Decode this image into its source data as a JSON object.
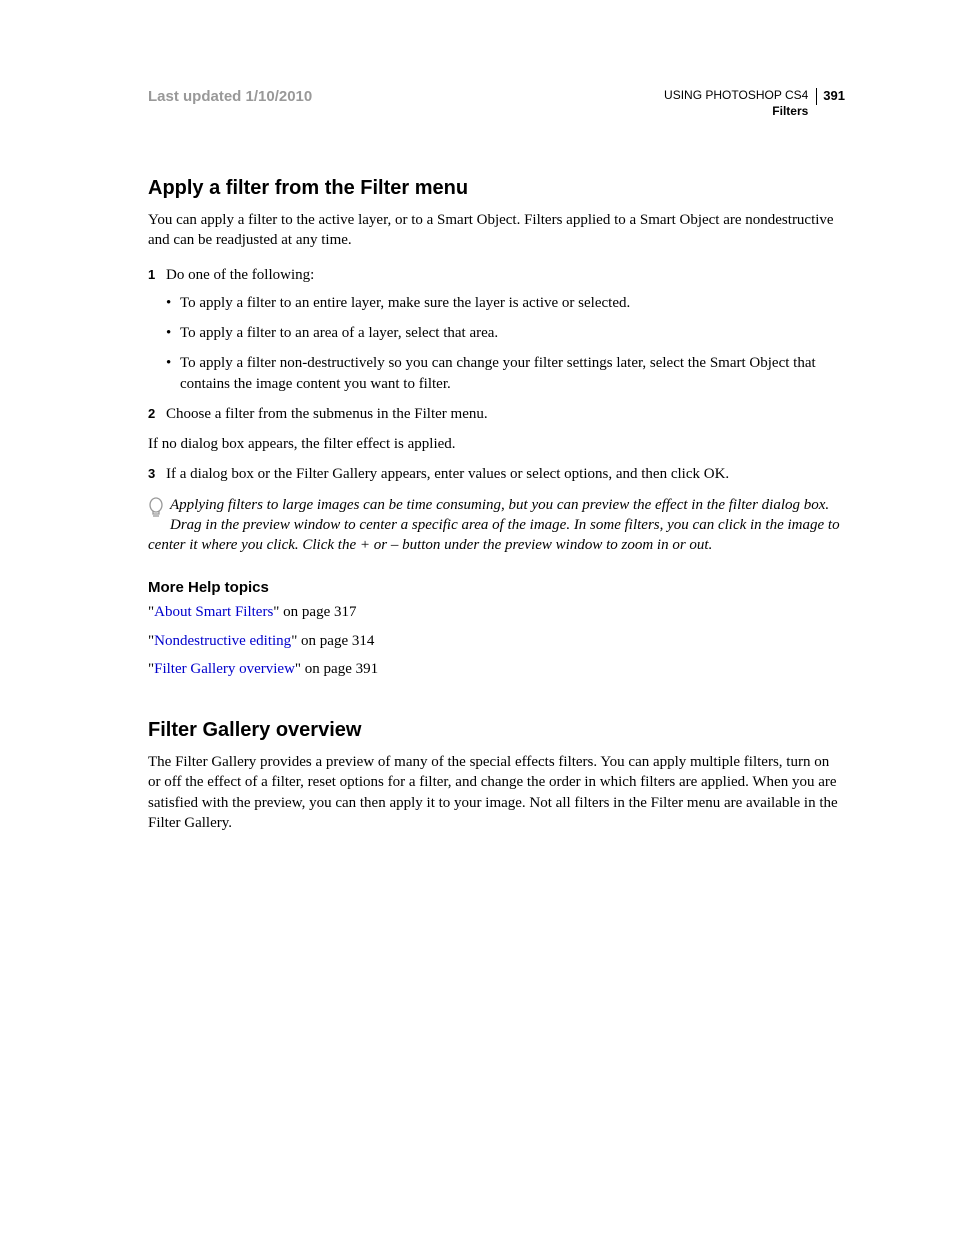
{
  "header": {
    "updated": "Last updated 1/10/2010",
    "product": "USING PHOTOSHOP CS4",
    "section": "Filters",
    "page_number": "391"
  },
  "section1": {
    "heading": "Apply a filter from the Filter menu",
    "intro": "You can apply a filter to the active layer, or to a Smart Object. Filters applied to a Smart Object are nondestructive and can be readjusted at any time.",
    "step1": "Do one of the following:",
    "bullets": [
      "To apply a filter to an entire layer, make sure the layer is active or selected.",
      "To apply a filter to an area of a layer, select that area.",
      "To apply a filter non-destructively so you can change your filter settings later, select the Smart Object that contains the image content you want to filter."
    ],
    "step2": "Choose a filter from the submenus in the Filter menu.",
    "afterstep2": "If no dialog box appears, the filter effect is applied.",
    "step3": "If a dialog box or the Filter Gallery appears, enter values or select options, and then click OK.",
    "tip": "Applying filters to large images can be time consuming, but you can preview the effect in the filter dialog box. Drag in the preview window to center a specific area of the image. In some filters, you can click in the image to center it where you click. Click the + or – button under the preview window to zoom in or out."
  },
  "morehelp": {
    "heading": "More Help topics",
    "links": [
      {
        "text": "About Smart Filters",
        "suffix": "\" on page 317"
      },
      {
        "text": "Nondestructive editing",
        "suffix": "\" on page 314"
      },
      {
        "text": "Filter Gallery overview",
        "suffix": "\" on page 391"
      }
    ]
  },
  "section2": {
    "heading": "Filter Gallery overview",
    "body": "The Filter Gallery provides a preview of many of the special effects filters. You can apply multiple filters, turn on or off the effect of a filter, reset options for a filter, and change the order in which filters are applied. When you are satisfied with the preview, you can then apply it to your image. Not all filters in the Filter menu are available in the Filter Gallery."
  }
}
